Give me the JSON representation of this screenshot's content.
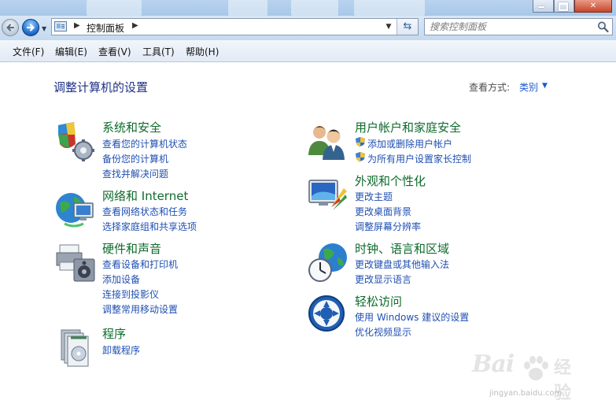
{
  "window": {
    "address_crumb": "控制面板",
    "search_placeholder": "搜索控制面板"
  },
  "menu": [
    "文件(F)",
    "编辑(E)",
    "查看(V)",
    "工具(T)",
    "帮助(H)"
  ],
  "page": {
    "title": "调整计算机的设置",
    "view_by_label": "查看方式:",
    "view_by_value": "类别"
  },
  "categories": [
    {
      "title": "系统和安全",
      "icon": "system-security-icon",
      "links": [
        "查看您的计算机状态",
        "备份您的计算机",
        "查找并解决问题"
      ]
    },
    {
      "title": "网络和 Internet",
      "icon": "network-internet-icon",
      "links": [
        "查看网络状态和任务",
        "选择家庭组和共享选项"
      ]
    },
    {
      "title": "硬件和声音",
      "icon": "hardware-sound-icon",
      "links": [
        "查看设备和打印机",
        "添加设备",
        "连接到投影仪",
        "调整常用移动设置"
      ]
    },
    {
      "title": "程序",
      "icon": "programs-icon",
      "links": [
        "卸载程序"
      ]
    },
    {
      "title": "用户帐户和家庭安全",
      "icon": "user-accounts-icon",
      "links": [
        "添加或删除用户帐户",
        "为所有用户设置家长控制"
      ]
    },
    {
      "title": "外观和个性化",
      "icon": "appearance-icon",
      "links": [
        "更改主题",
        "更改桌面背景",
        "调整屏幕分辨率"
      ]
    },
    {
      "title": "时钟、语言和区域",
      "icon": "clock-language-region-icon",
      "links": [
        "更改键盘或其他输入法",
        "更改显示语言"
      ]
    },
    {
      "title": "轻松访问",
      "icon": "ease-of-access-icon",
      "links": [
        "使用 Windows 建议的设置",
        "优化视频显示"
      ]
    }
  ],
  "watermark": {
    "logo": "Bai",
    "logo2": "经验",
    "url": "jingyan.baidu.com"
  },
  "colors": {
    "category_title": "#0e6b2c",
    "link": "#1f4fb3",
    "page_title": "#1e3287"
  }
}
